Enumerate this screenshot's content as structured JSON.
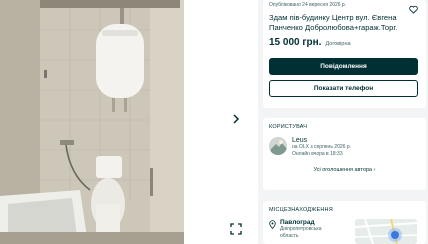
{
  "listing": {
    "published": "Опубліковано 24 вересня 2026 р.",
    "title": "Здам пів-будинку Центр вул. Євгена Панченко Добролюбова+гараж.Торг.",
    "price": "15 000 грн.",
    "negotiable": "Договірна",
    "message_button": "Повідомлення",
    "phone_button": "Показати телефон"
  },
  "user": {
    "section_title": "КОРИСТУВАЧ",
    "name": "Leus",
    "member_since": "на OLX з серпень 2026 р.",
    "last_online": "Онлайн вчора в 18:33",
    "all_ads_link": "Усі оголошення автора"
  },
  "location": {
    "section_title": "МІСЦЕЗНАХОДЖЕННЯ",
    "city": "Павлоград",
    "region_line1": "Дніпропетровська",
    "region_line2": "область"
  },
  "colors": {
    "accent": "#002f34",
    "secondary_text": "#406367",
    "background": "#f2f4f5"
  },
  "icons": {
    "favorite": "heart-outline-icon",
    "next": "chevron-right-icon",
    "fullscreen": "expand-icon",
    "pin": "location-pin-icon"
  }
}
